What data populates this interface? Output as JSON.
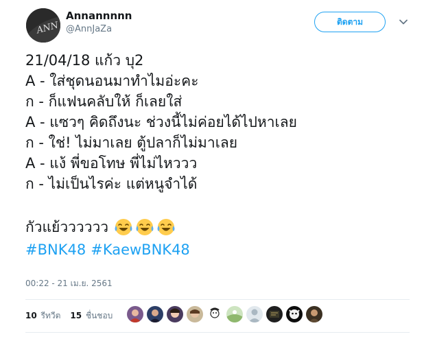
{
  "author": {
    "display_name": "Annannnnn",
    "handle": "@AnnJaZa"
  },
  "follow_button": {
    "label": "ติดตาม"
  },
  "tweet": {
    "lines": [
      "21/04/18 แก้ว บุ2",
      "A - ใส่ชุดนอนมาทำไมอ่ะคะ",
      "ก - ก็แฟนคลับให้ ก็เลยใส่",
      "A - แซวๆ คิดถึงนะ ช่วงนี้ไม่ค่อยได้ไปหาเลย",
      "ก - ใช่! ไม่มาเลย ตู้ปลาก็ไม่มาเลย",
      "A - แง้ พี่ขอโทษ พี่ไม่ไหววว",
      "ก - ไม่เป็นไรค่ะ แต่หนูจำได้"
    ],
    "closing_text": "กัวแย้วววววว",
    "emoji_icons": [
      "tears-of-joy-emoji",
      "tears-of-joy-emoji",
      "tears-of-joy-emoji"
    ],
    "hashtags": [
      "#BNK48",
      "#KaewBNK48"
    ]
  },
  "timestamp": "00:22 - 21 เม.ย. 2561",
  "stats": {
    "retweet_count": "10",
    "retweet_label": "รีทวีต",
    "like_count": "15",
    "like_label": "ชื่นชอบ"
  },
  "likers": [
    "avatar-1",
    "avatar-2",
    "avatar-3",
    "avatar-4",
    "avatar-5",
    "avatar-6",
    "avatar-7",
    "avatar-8",
    "avatar-9"
  ],
  "colors": {
    "accent": "#1da1f2",
    "text": "#14171a",
    "muted": "#657786",
    "divider": "#e6ecf0"
  }
}
